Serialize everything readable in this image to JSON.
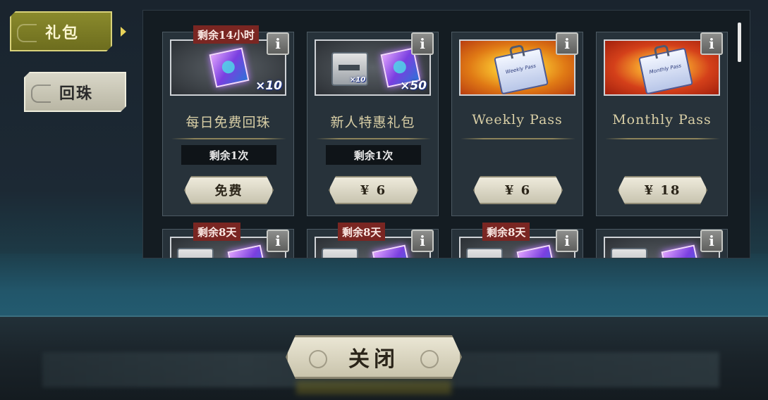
{
  "sidebar": {
    "tabs": [
      {
        "label": "礼包",
        "active": true
      },
      {
        "label": "回珠",
        "active": false
      }
    ]
  },
  "cards": [
    {
      "timer": "剩余14小时",
      "name": "每日免费回珠",
      "remaining": "剩余1次",
      "price": "免费",
      "art": "cube",
      "multiplier": "×10"
    },
    {
      "timer": "",
      "name": "新人特惠礼包",
      "remaining": "剩余1次",
      "price": "¥ 6",
      "art": "ticket+cube",
      "ticket_multiplier": "×10",
      "multiplier": "×50"
    },
    {
      "timer": "",
      "name": "Weekly Pass",
      "remaining": "",
      "price": "¥ 6",
      "art": "pass",
      "pass_text": "Weekly Pass"
    },
    {
      "timer": "",
      "name": "Monthly Pass",
      "remaining": "",
      "price": "¥ 18",
      "art": "pass",
      "pass_text": "Monthly Pass"
    }
  ],
  "row2_timers": [
    "剩余8天",
    "剩余8天",
    "剩余8天"
  ],
  "info_label": "i",
  "close_button": "关闭",
  "colors": {
    "active_tab": "#7b7b26",
    "timer_badge": "#7a2622",
    "panel_bg": "#141c22"
  }
}
